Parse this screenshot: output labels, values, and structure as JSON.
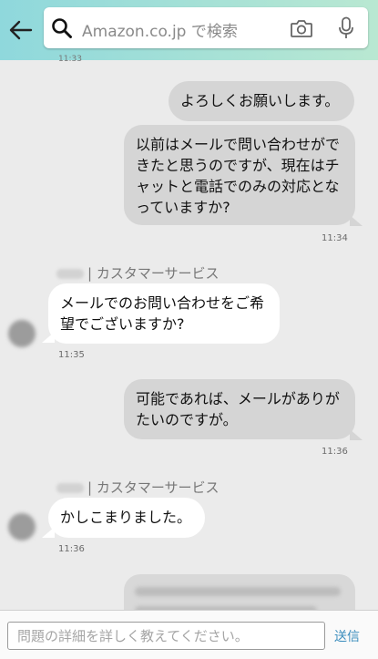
{
  "search": {
    "placeholder": "Amazon.co.jp で検索"
  },
  "messages": [
    {
      "text": "よろしくお願いします。"
    },
    {
      "text": "以前はメールで問い合わせができたと思うのですが、現在はチャットと電話でのみの対応となっていますか?",
      "time": "11:34"
    },
    {
      "agent": "| カスタマーサービス",
      "text": "メールでのお問い合わせをご希望でございますか?",
      "time": "11:35"
    },
    {
      "text": "可能であれば、メールがありがたいのですが。",
      "time": "11:36"
    },
    {
      "agent": "| カスタマーサービス",
      "text": "かしこまりました。",
      "time": "11:36"
    }
  ],
  "composer": {
    "placeholder": "問題の詳細を詳しく教えてください。",
    "send_label": "送信"
  },
  "colors": {
    "accent": "#3b8dbd",
    "header_start": "#8fd8dc",
    "header_end": "#b9e8d2"
  }
}
